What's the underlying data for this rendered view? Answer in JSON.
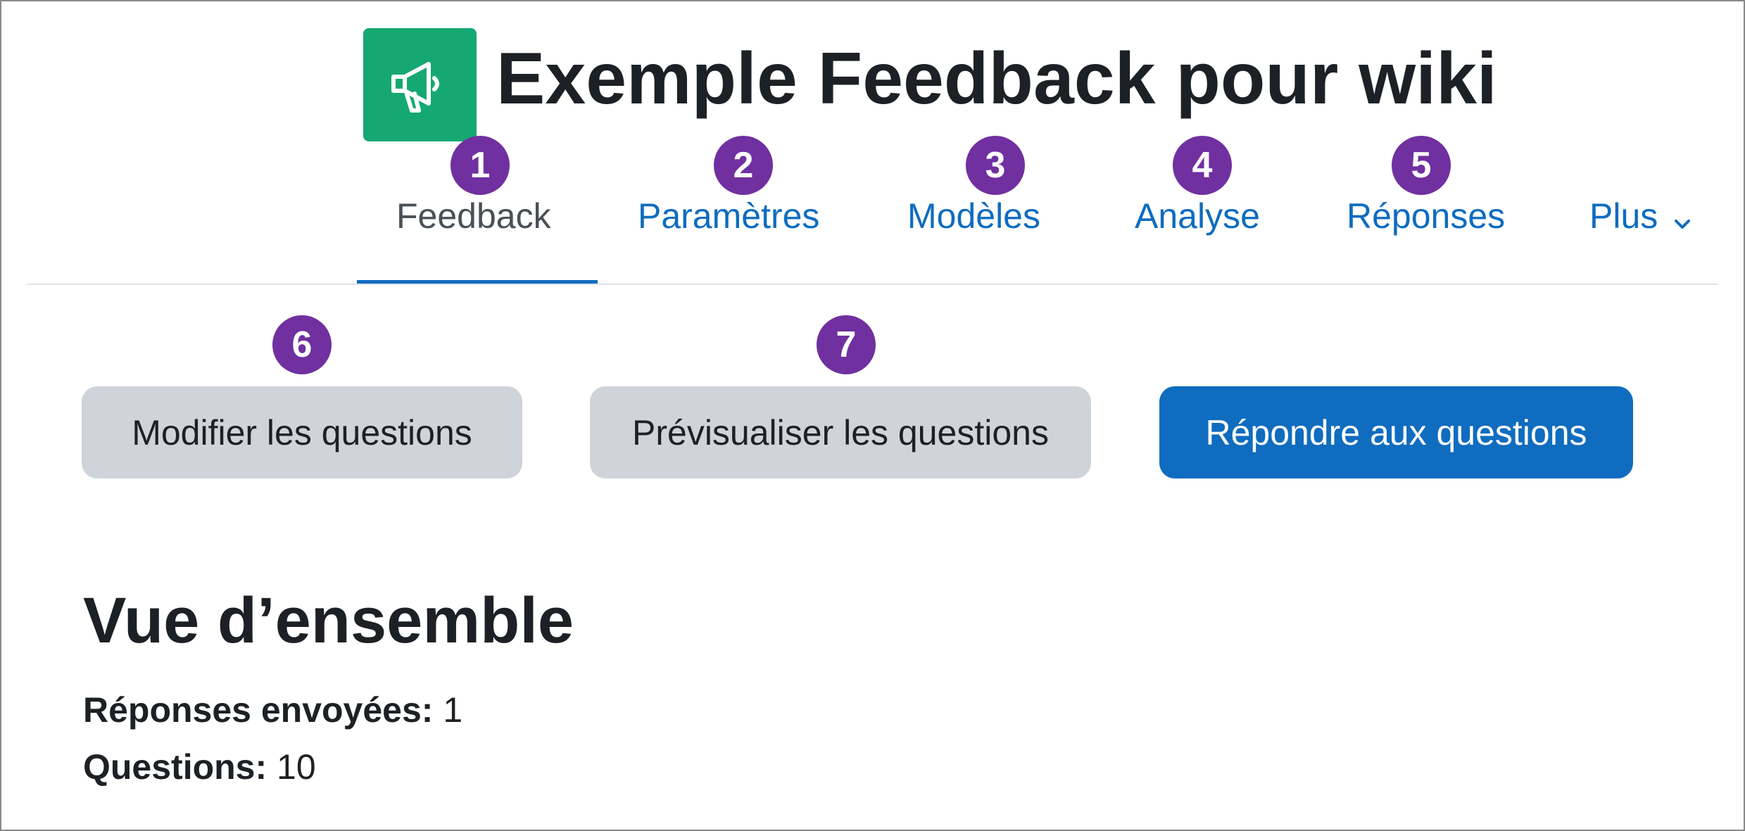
{
  "header": {
    "title": "Exemple Feedback pour wiki",
    "icon": "megaphone-icon",
    "icon_color": "#15a872"
  },
  "tabs": [
    {
      "label": "Feedback",
      "active": true
    },
    {
      "label": "Paramètres",
      "active": false
    },
    {
      "label": "Modèles",
      "active": false
    },
    {
      "label": "Analyse",
      "active": false
    },
    {
      "label": "Réponses",
      "active": false
    },
    {
      "label": "Plus",
      "active": false,
      "icon": "chevron-down-icon"
    }
  ],
  "badges": [
    "1",
    "2",
    "3",
    "4",
    "5",
    "6",
    "7"
  ],
  "actions": {
    "edit_questions": "Modifier les questions",
    "preview_questions": "Prévisualiser les questions",
    "answer_questions": "Répondre aux questions"
  },
  "overview": {
    "title": "Vue d’ensemble",
    "submitted_label": "Réponses envoyées:",
    "submitted_value": "1",
    "questions_label": "Questions:",
    "questions_value": "10"
  },
  "colors": {
    "primary": "#0f6cbf",
    "secondary_button": "#ced4da",
    "badge": "#7030a0",
    "text": "#1d2125"
  }
}
